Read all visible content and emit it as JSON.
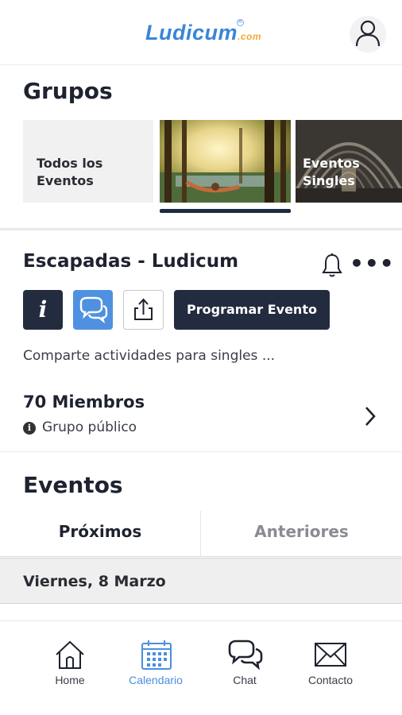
{
  "header": {
    "logo_text": "Ludicum",
    "logo_suffix": ".com",
    "logo_reg": "R"
  },
  "groups": {
    "title": "Grupos",
    "tiles": [
      {
        "label_line1": "Todos los",
        "label_line2": "Eventos"
      },
      {
        "label_line1": "",
        "label_line2": ""
      },
      {
        "label_line1": "Eventos",
        "label_line2": "Singles"
      }
    ]
  },
  "group_detail": {
    "name": "Escapadas - Ludicum",
    "more_glyph": "•••",
    "info_glyph": "i",
    "program_label": "Programar Evento",
    "description": "Comparte actividades para singles ...",
    "members": "70 Miembros",
    "privacy_glyph": "i",
    "privacy": "Grupo público"
  },
  "events": {
    "title": "Eventos",
    "tabs": {
      "upcoming": "Próximos",
      "past": "Anteriores"
    },
    "date_header": "Viernes, 8 Marzo"
  },
  "bottom_nav": {
    "home": "Home",
    "calendar": "Calendario",
    "chat": "Chat",
    "contact": "Contacto",
    "active": "calendar"
  },
  "colors": {
    "accent": "#4a8fdf",
    "dark_button": "#232b3f",
    "logo_blue": "#3a86d8",
    "logo_orange": "#f0a93a"
  }
}
